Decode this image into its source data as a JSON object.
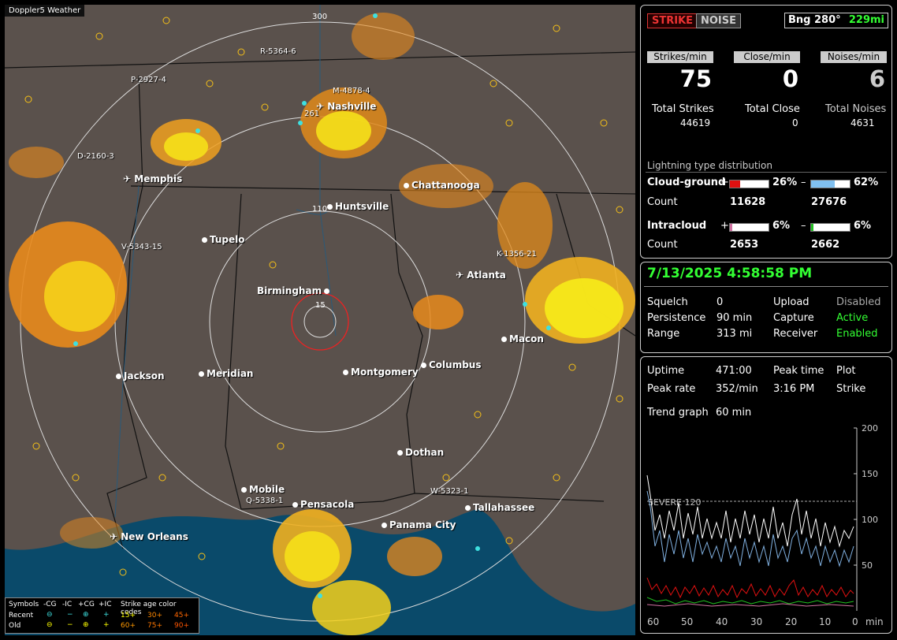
{
  "map": {
    "title": "Doppler5 Weather",
    "ring_labels": [
      "300",
      "110",
      "15"
    ],
    "cities": [
      "Nashville",
      "Memphis",
      "Chattanooga",
      "Huntsville",
      "Tupelo",
      "Atlanta",
      "Birmingham",
      "Macon",
      "Jackson",
      "Meridian",
      "Montgomery",
      "Columbus",
      "Dothan",
      "Mobile",
      "Pensacola",
      "Tallahassee",
      "Panama City",
      "New Orleans"
    ],
    "storms": [
      "R-5364-6",
      "M-4878-4",
      "P-2927-4",
      "D-2160-3",
      "V-5343-15",
      "K-1356-21",
      "Q-5338-1",
      "W-5323-1",
      "261"
    ]
  },
  "legend": {
    "symbols": "Symbols",
    "neg_cg": "-CG",
    "neg_ic": "-IC",
    "pos_cg": "+CG",
    "pos_ic": "+IC",
    "age_codes": "Strike age color codes",
    "recent": "Recent",
    "old": "Old",
    "ages": [
      "15+",
      "30+",
      "45+",
      "60+",
      "75+",
      "90+"
    ],
    "age_colors": [
      "#ffff00",
      "#ffa500",
      "#ff8c00",
      "#ff7f00",
      "#ff6a00",
      "#ff4500"
    ]
  },
  "status": {
    "strike_button": "STRIKE",
    "noise_button": "NOISE",
    "bearing": "Bng 280°",
    "distance": "229mi",
    "strikes_per_min_label": "Strikes/min",
    "close_per_min_label": "Close/min",
    "noises_per_min_label": "Noises/min",
    "strikes_per_min": "75",
    "close_per_min": "0",
    "noises_per_min": "6",
    "total_strikes_label": "Total Strikes",
    "total_close_label": "Total Close",
    "total_noises_label": "Total Noises",
    "total_strikes": "44619",
    "total_close": "0",
    "total_noises": "4631",
    "dist_title": "Lightning type distribution",
    "cg_label": "Cloud-ground",
    "ic_label": "Intracloud",
    "count_label": "Count",
    "plus": "+",
    "minus": "–",
    "cg_pos_pct": "26%",
    "cg_neg_pct": "62%",
    "cg_pos_count": "11628",
    "cg_neg_count": "27676",
    "ic_pos_pct": "6%",
    "ic_neg_pct": "6%",
    "ic_pos_count": "2653",
    "ic_neg_count": "2662",
    "cg_pos_frac": 0.26,
    "cg_neg_frac": 0.62,
    "ic_pos_frac": 0.06,
    "ic_neg_frac": 0.06
  },
  "settings": {
    "datetime": "7/13/2025 4:58:58 PM",
    "squelch_label": "Squelch",
    "squelch": "0",
    "persistence_label": "Persistence",
    "persistence": "90 min",
    "range_label": "Range",
    "range": "313 mi",
    "upload_label": "Upload",
    "upload": "Disabled",
    "capture_label": "Capture",
    "capture": "Active",
    "receiver_label": "Receiver",
    "receiver": "Enabled"
  },
  "stats": {
    "uptime_label": "Uptime",
    "uptime": "471:00",
    "peak_time_label": "Peak time",
    "peak_time": "3:16 PM",
    "plot_label": "Plot",
    "plot": "Strike",
    "peak_rate_label": "Peak rate",
    "peak_rate": "352/min",
    "trend_label": "Trend graph",
    "trend": "60 min",
    "severe_label": "SEVERE 120",
    "y_ticks": [
      "200",
      "150",
      "100",
      "50"
    ],
    "x_ticks": [
      "60",
      "50",
      "40",
      "30",
      "20",
      "10",
      "0"
    ],
    "x_unit": "min"
  }
}
